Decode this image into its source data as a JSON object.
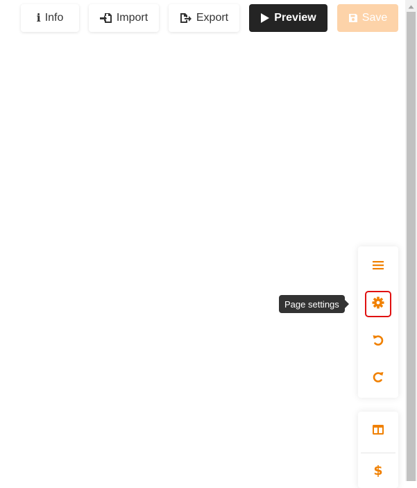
{
  "toolbar": {
    "info_label": "Info",
    "import_label": "Import",
    "export_label": "Export",
    "preview_label": "Preview",
    "save_label": "Save"
  },
  "side_panel": {
    "top_items": [
      {
        "icon": "menu-icon"
      },
      {
        "icon": "gear-icon",
        "tooltip": "Page settings"
      },
      {
        "icon": "undo-icon"
      },
      {
        "icon": "redo-icon"
      }
    ],
    "bottom_items": [
      {
        "icon": "columns-layout-icon"
      },
      {
        "icon": "dollar-icon",
        "glyph": "$"
      }
    ]
  },
  "colors": {
    "accent": "#f08000",
    "preview_bg": "#242424",
    "save_bg_disabled": "#fdd3a9",
    "highlight_border": "#e01010",
    "tooltip_bg": "#333333"
  }
}
